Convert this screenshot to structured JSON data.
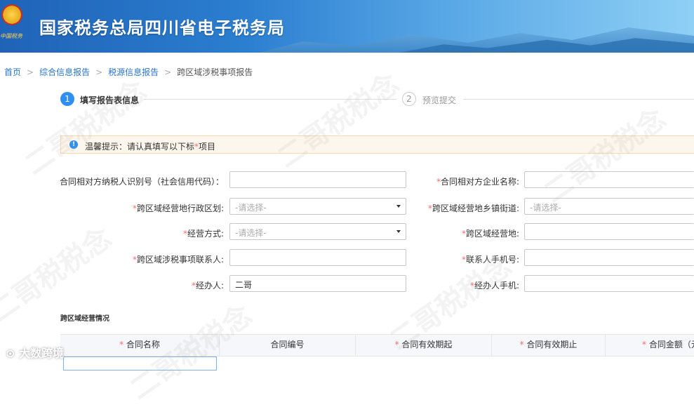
{
  "header": {
    "title": "国家税务总局四川省电子税务局",
    "emblem_caption": "中国税务"
  },
  "breadcrumb": [
    "首页",
    "综合信息报告",
    "税源信息报告",
    "跨区域涉税事项报告"
  ],
  "steps": [
    {
      "num": "1",
      "label": "填写报告表信息"
    },
    {
      "num": "2",
      "label": "预览提交"
    }
  ],
  "tip": {
    "prefix": "温馨提示：请认真填写以下标",
    "star": "*",
    "suffix": "项目"
  },
  "form": {
    "counterpart_tax_id": {
      "label": "合同相对方纳税人识别号（社会信用代码）：",
      "value": ""
    },
    "counterpart_name": {
      "label": "合同相对方企业名称:",
      "value": ""
    },
    "admin_region": {
      "label": "跨区域经营地行政区划:",
      "placeholder": "-请选择-"
    },
    "township": {
      "label": "跨区域经营地乡镇街道:",
      "placeholder": "-请选择-"
    },
    "business_mode": {
      "label": "经营方式:",
      "placeholder": "-请选择-"
    },
    "business_location": {
      "label": "跨区域经营地:",
      "value": ""
    },
    "contact_person": {
      "label": "跨区域涉税事项联系人:",
      "value": ""
    },
    "contact_phone": {
      "label": "联系人手机号:",
      "value": ""
    },
    "handler": {
      "label": "经办人:",
      "value": "二哥"
    },
    "handler_phone": {
      "label": "经办人手机:",
      "value": ""
    }
  },
  "section_title": "跨区域经营情况",
  "table": {
    "columns": [
      "合同名称",
      "合同编号",
      "合同有效期起",
      "合同有效期止",
      "合同金额（元"
    ]
  },
  "watermark_text": "二哥税税念",
  "corner_logo": "大数跨境",
  "colors": {
    "primary": "#2f8ff0",
    "required": "#f56c6c",
    "link": "#2a75c9"
  }
}
